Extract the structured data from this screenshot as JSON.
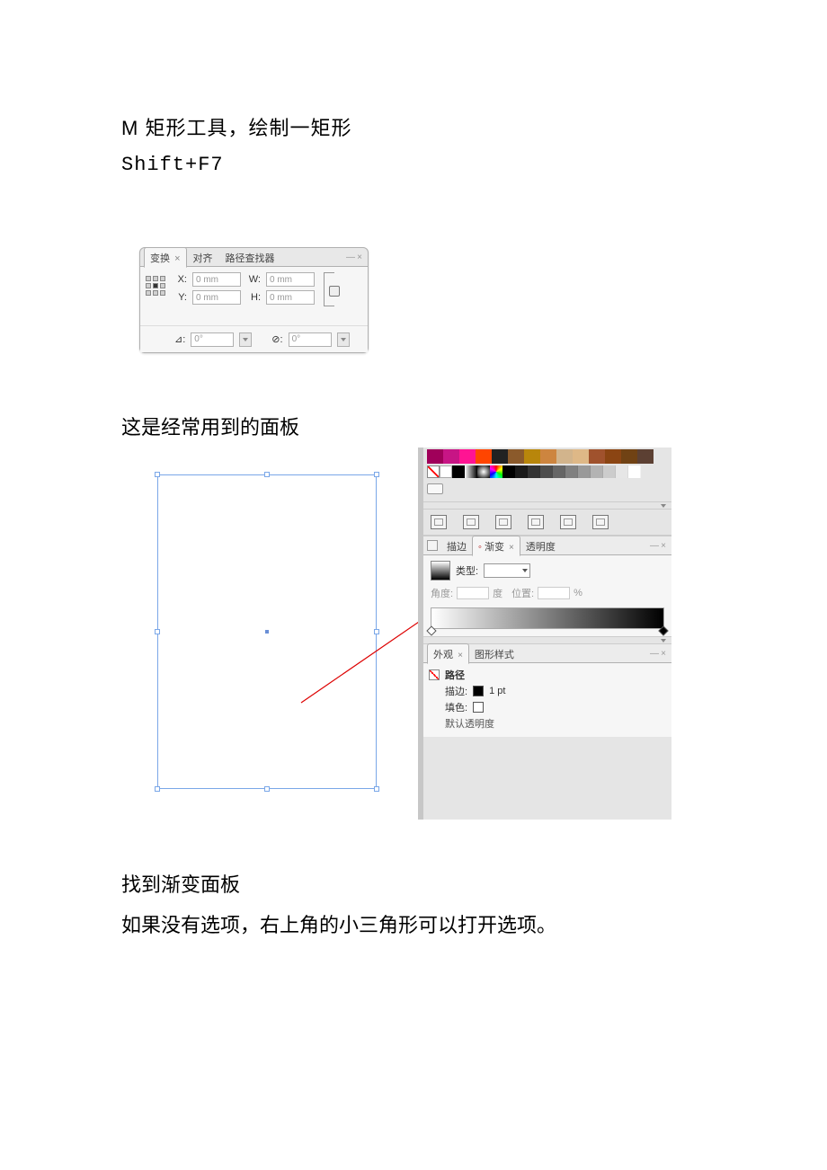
{
  "doc": {
    "line1": "M 矩形工具，绘制一矩形",
    "line2": "Shift+F7",
    "caption2": "这是经常用到的面板",
    "bottom1": "找到渐变面板",
    "bottom2": "如果没有选项，右上角的小三角形可以打开选项。"
  },
  "transform_panel": {
    "tabs": {
      "transform": "变换",
      "align": "对齐",
      "pathfinder": "路径查找器"
    },
    "labels": {
      "X": "X:",
      "Y": "Y:",
      "W": "W:",
      "H": "H:",
      "rotate": "⊿:",
      "shear": "⊘:"
    },
    "values": {
      "X": "0 mm",
      "Y": "0 mm",
      "W": "0 mm",
      "H": "0 mm",
      "rotate": "0°",
      "shear": "0°"
    }
  },
  "swatches": {
    "row1_colors": [
      "#a0005a",
      "#c71585",
      "#ff1493",
      "#ff4500",
      "#222222",
      "#8b5a2b",
      "#b8860b",
      "#cd853f",
      "#d2b48c",
      "#deb887",
      "#a0522d",
      "#8b4513",
      "#704214",
      "#5c4033"
    ],
    "greys": [
      "#000",
      "#1a1a1a",
      "#333",
      "#4d4d4d",
      "#666",
      "#808080",
      "#999",
      "#b3b3b3",
      "#ccc",
      "#e6e6e6",
      "#fff"
    ]
  },
  "gradient_panel": {
    "tabs": {
      "stroke": "描边",
      "gradient": "渐变",
      "transparency": "透明度"
    },
    "type_label": "类型:",
    "angle_label": "角度:",
    "deg_label": "度",
    "location_label": "位置:",
    "pct": "%"
  },
  "appearance_panel": {
    "tabs": {
      "appearance": "外观",
      "graphic_styles": "图形样式"
    },
    "path": "路径",
    "stroke_label": "描边:",
    "stroke_value": "1 pt",
    "fill_label": "填色:",
    "default_label": "默认透明度"
  }
}
